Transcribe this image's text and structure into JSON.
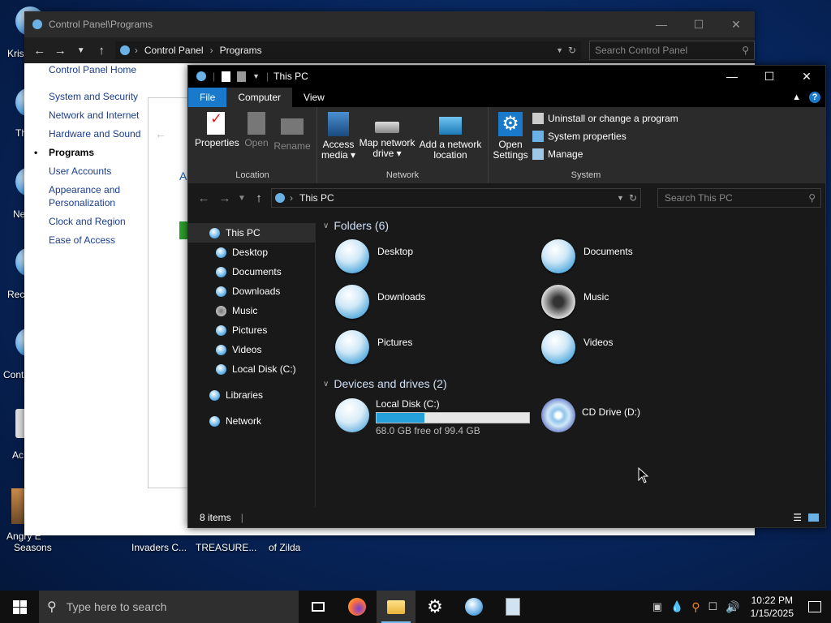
{
  "desktop": {
    "labels": [
      "Kris",
      "Th",
      "Ne",
      "Recy",
      "Contr",
      "Ac",
      "Angry E",
      "Seasons",
      "Invaders C...",
      "TREASURE...",
      "of Zilda"
    ]
  },
  "control_panel": {
    "title": "Control Panel\\Programs",
    "breadcrumb": [
      "Control Panel",
      "Programs"
    ],
    "search_placeholder": "Search Control Panel",
    "sidebar": [
      "Control Panel Home",
      "System and Security",
      "Network and Internet",
      "Hardware and Sound",
      "Programs",
      "User Accounts",
      "Appearance and Personalization",
      "Clock and Region",
      "Ease of Access"
    ],
    "current": "Programs",
    "partial_letter": "A"
  },
  "explorer": {
    "title": "This PC",
    "tabs": {
      "file": "File",
      "computer": "Computer",
      "view": "View"
    },
    "ribbon": {
      "location": {
        "name": "Location",
        "properties": "Properties",
        "open": "Open",
        "rename": "Rename"
      },
      "network": {
        "name": "Network",
        "access_media": "Access media ▾",
        "map_drive": "Map network drive ▾",
        "add_location": "Add a network location"
      },
      "system": {
        "name": "System",
        "open_settings": "Open Settings",
        "uninstall": "Uninstall or change a program",
        "system_properties": "System properties",
        "manage": "Manage"
      }
    },
    "address": "This PC",
    "search_placeholder": "Search This PC",
    "nav": {
      "this_pc": "This PC",
      "children": [
        "Desktop",
        "Documents",
        "Downloads",
        "Music",
        "Pictures",
        "Videos",
        "Local Disk (C:)"
      ],
      "libraries": "Libraries",
      "network": "Network"
    },
    "folders_header": "Folders (6)",
    "folders": [
      "Desktop",
      "Documents",
      "Downloads",
      "Music",
      "Pictures",
      "Videos"
    ],
    "devices_header": "Devices and drives (2)",
    "drives": [
      {
        "name": "Local Disk (C:)",
        "detail": "68.0 GB free of 99.4 GB",
        "used_fraction": 0.316
      },
      {
        "name": "CD Drive (D:)"
      }
    ],
    "status": "8 items"
  },
  "taskbar": {
    "search_placeholder": "Type here to search",
    "time": "10:22 PM",
    "date": "1/15/2025"
  }
}
